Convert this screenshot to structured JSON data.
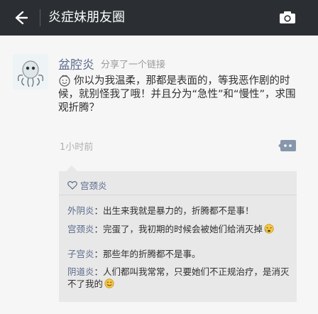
{
  "header": {
    "back_icon": "back-arrow-icon",
    "title": "炎症妹朋友圈",
    "camera_icon": "camera-icon"
  },
  "post": {
    "author": "盆腔炎",
    "shared_text": "分享了一个链接",
    "body": "你以为我温柔，那都是表面的，等我恶作剧的时候，就别怪我了哦！并且分为“急性”和“慢性”，求围观折腾？",
    "body_emoji_icon": "smiling-face-icon",
    "time": "1小时前",
    "comment_icon": "comment-dots-icon"
  },
  "social": {
    "likes": "宫颈炎",
    "comments": [
      {
        "name": "外阴炎",
        "sep": "：",
        "text": "出生来我就是暴力的，折腾都不是事！",
        "emoji": ""
      },
      {
        "name": "宫颈炎",
        "sep": "：",
        "text": "完蛋了，我初期的时候会被她们给消灭掉",
        "emoji": "tired-face-icon"
      },
      {
        "name": "子宫炎",
        "sep": "：",
        "text": "那些年的折腾都不是事。",
        "emoji": ""
      },
      {
        "name": "阴道炎",
        "sep": "：",
        "text": "人们都叫我常常，只要她们不正规治疗，是消灭不了我的",
        "emoji": "smiling-face-icon"
      }
    ]
  },
  "colors": {
    "topbar": "#2b2f33",
    "link_name": "#5b6b8c",
    "background": "#f6f6f6",
    "comment_panel": "#e8e8e8"
  }
}
